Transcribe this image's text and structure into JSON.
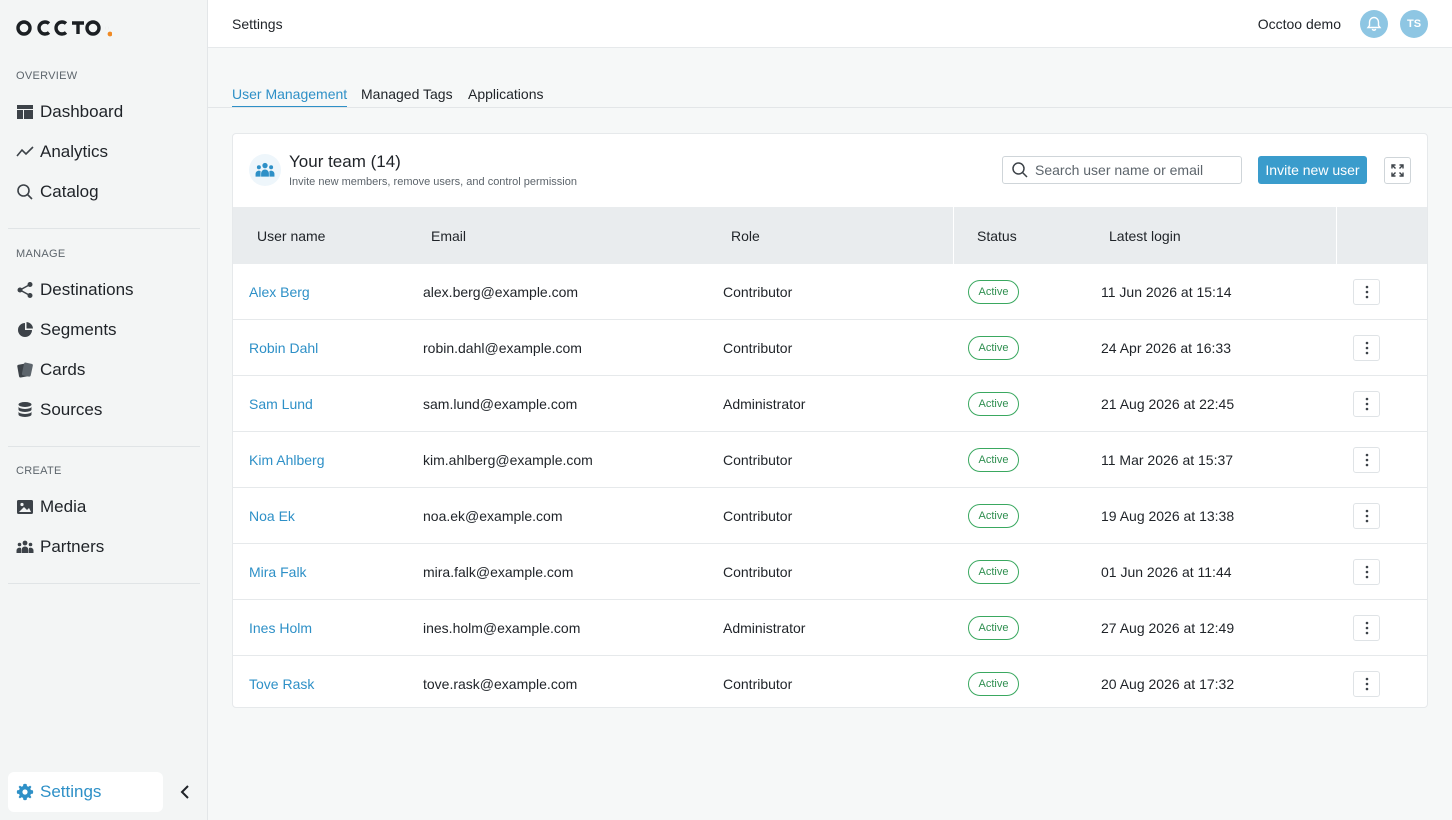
{
  "brand": {
    "logo_text": "OCCTOO",
    "accent": "#2e90c7",
    "logo_dot": "#f08a24"
  },
  "sidebar": {
    "sections": [
      {
        "label": "OVERVIEW",
        "items": [
          {
            "label": "Dashboard",
            "icon": "dashboard-icon"
          },
          {
            "label": "Analytics",
            "icon": "trend-line-icon"
          },
          {
            "label": "Catalog",
            "icon": "search-icon"
          }
        ]
      },
      {
        "label": "MANAGE",
        "items": [
          {
            "label": "Destinations",
            "icon": "share-icon"
          },
          {
            "label": "Segments",
            "icon": "pie-chart-icon"
          },
          {
            "label": "Cards",
            "icon": "cards-icon"
          },
          {
            "label": "Sources",
            "icon": "database-icon"
          }
        ]
      },
      {
        "label": "CREATE",
        "items": [
          {
            "label": "Media",
            "icon": "image-icon"
          },
          {
            "label": "Partners",
            "icon": "people-icon"
          }
        ]
      }
    ],
    "settings_label": "Settings"
  },
  "header": {
    "title": "Settings",
    "org_name": "Occtoo demo",
    "avatar_initials": "TS"
  },
  "tabs": [
    {
      "label": "User Management",
      "active": true
    },
    {
      "label": "Managed Tags",
      "active": false
    },
    {
      "label": "Applications",
      "active": false
    }
  ],
  "team": {
    "title": "Your team (14)",
    "subtitle": "Invite new members, remove users, and control permission",
    "search_placeholder": "Search user name or email",
    "invite_label": "Invite new user"
  },
  "table": {
    "columns": [
      "User name",
      "Email",
      "Role",
      "Status",
      "Latest login"
    ],
    "rows": [
      {
        "name": "Alex Berg",
        "email": "alex.berg@example.com",
        "role": "Contributor",
        "status": "Active",
        "login": "11 Jun 2026 at 15:14"
      },
      {
        "name": "Robin Dahl",
        "email": "robin.dahl@example.com",
        "role": "Contributor",
        "status": "Active",
        "login": "24 Apr 2026 at 16:33"
      },
      {
        "name": "Sam Lund",
        "email": "sam.lund@example.com",
        "role": "Administrator",
        "status": "Active",
        "login": "21 Aug 2026 at 22:45"
      },
      {
        "name": "Kim Ahlberg",
        "email": "kim.ahlberg@example.com",
        "role": "Contributor",
        "status": "Active",
        "login": "11 Mar 2026 at 15:37"
      },
      {
        "name": "Noa Ek",
        "email": "noa.ek@example.com",
        "role": "Contributor",
        "status": "Active",
        "login": "19 Aug 2026 at 13:38"
      },
      {
        "name": "Mira Falk",
        "email": "mira.falk@example.com",
        "role": "Contributor",
        "status": "Active",
        "login": "01 Jun 2026 at 11:44"
      },
      {
        "name": "Ines Holm",
        "email": "ines.holm@example.com",
        "role": "Administrator",
        "status": "Active",
        "login": "27 Aug 2026 at 12:49"
      },
      {
        "name": "Tove Rask",
        "email": "tove.rask@example.com",
        "role": "Contributor",
        "status": "Active",
        "login": "20 Aug 2026 at 17:32"
      }
    ]
  }
}
